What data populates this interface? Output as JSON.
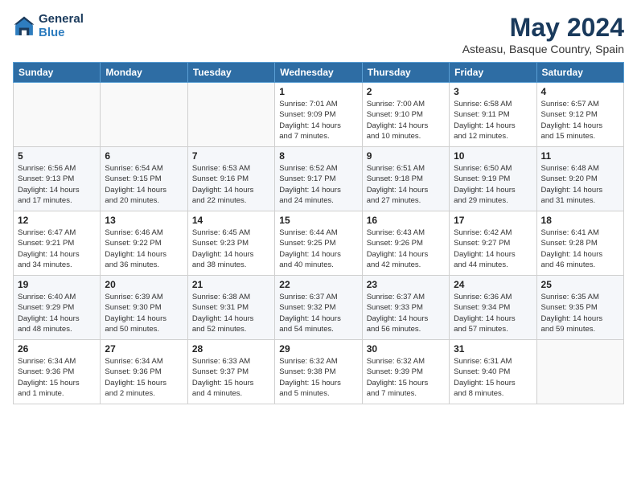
{
  "header": {
    "logo_line1": "General",
    "logo_line2": "Blue",
    "month_year": "May 2024",
    "location": "Asteasu, Basque Country, Spain"
  },
  "weekdays": [
    "Sunday",
    "Monday",
    "Tuesday",
    "Wednesday",
    "Thursday",
    "Friday",
    "Saturday"
  ],
  "weeks": [
    [
      {
        "day": "",
        "info": ""
      },
      {
        "day": "",
        "info": ""
      },
      {
        "day": "",
        "info": ""
      },
      {
        "day": "1",
        "info": "Sunrise: 7:01 AM\nSunset: 9:09 PM\nDaylight: 14 hours\nand 7 minutes."
      },
      {
        "day": "2",
        "info": "Sunrise: 7:00 AM\nSunset: 9:10 PM\nDaylight: 14 hours\nand 10 minutes."
      },
      {
        "day": "3",
        "info": "Sunrise: 6:58 AM\nSunset: 9:11 PM\nDaylight: 14 hours\nand 12 minutes."
      },
      {
        "day": "4",
        "info": "Sunrise: 6:57 AM\nSunset: 9:12 PM\nDaylight: 14 hours\nand 15 minutes."
      }
    ],
    [
      {
        "day": "5",
        "info": "Sunrise: 6:56 AM\nSunset: 9:13 PM\nDaylight: 14 hours\nand 17 minutes."
      },
      {
        "day": "6",
        "info": "Sunrise: 6:54 AM\nSunset: 9:15 PM\nDaylight: 14 hours\nand 20 minutes."
      },
      {
        "day": "7",
        "info": "Sunrise: 6:53 AM\nSunset: 9:16 PM\nDaylight: 14 hours\nand 22 minutes."
      },
      {
        "day": "8",
        "info": "Sunrise: 6:52 AM\nSunset: 9:17 PM\nDaylight: 14 hours\nand 24 minutes."
      },
      {
        "day": "9",
        "info": "Sunrise: 6:51 AM\nSunset: 9:18 PM\nDaylight: 14 hours\nand 27 minutes."
      },
      {
        "day": "10",
        "info": "Sunrise: 6:50 AM\nSunset: 9:19 PM\nDaylight: 14 hours\nand 29 minutes."
      },
      {
        "day": "11",
        "info": "Sunrise: 6:48 AM\nSunset: 9:20 PM\nDaylight: 14 hours\nand 31 minutes."
      }
    ],
    [
      {
        "day": "12",
        "info": "Sunrise: 6:47 AM\nSunset: 9:21 PM\nDaylight: 14 hours\nand 34 minutes."
      },
      {
        "day": "13",
        "info": "Sunrise: 6:46 AM\nSunset: 9:22 PM\nDaylight: 14 hours\nand 36 minutes."
      },
      {
        "day": "14",
        "info": "Sunrise: 6:45 AM\nSunset: 9:23 PM\nDaylight: 14 hours\nand 38 minutes."
      },
      {
        "day": "15",
        "info": "Sunrise: 6:44 AM\nSunset: 9:25 PM\nDaylight: 14 hours\nand 40 minutes."
      },
      {
        "day": "16",
        "info": "Sunrise: 6:43 AM\nSunset: 9:26 PM\nDaylight: 14 hours\nand 42 minutes."
      },
      {
        "day": "17",
        "info": "Sunrise: 6:42 AM\nSunset: 9:27 PM\nDaylight: 14 hours\nand 44 minutes."
      },
      {
        "day": "18",
        "info": "Sunrise: 6:41 AM\nSunset: 9:28 PM\nDaylight: 14 hours\nand 46 minutes."
      }
    ],
    [
      {
        "day": "19",
        "info": "Sunrise: 6:40 AM\nSunset: 9:29 PM\nDaylight: 14 hours\nand 48 minutes."
      },
      {
        "day": "20",
        "info": "Sunrise: 6:39 AM\nSunset: 9:30 PM\nDaylight: 14 hours\nand 50 minutes."
      },
      {
        "day": "21",
        "info": "Sunrise: 6:38 AM\nSunset: 9:31 PM\nDaylight: 14 hours\nand 52 minutes."
      },
      {
        "day": "22",
        "info": "Sunrise: 6:37 AM\nSunset: 9:32 PM\nDaylight: 14 hours\nand 54 minutes."
      },
      {
        "day": "23",
        "info": "Sunrise: 6:37 AM\nSunset: 9:33 PM\nDaylight: 14 hours\nand 56 minutes."
      },
      {
        "day": "24",
        "info": "Sunrise: 6:36 AM\nSunset: 9:34 PM\nDaylight: 14 hours\nand 57 minutes."
      },
      {
        "day": "25",
        "info": "Sunrise: 6:35 AM\nSunset: 9:35 PM\nDaylight: 14 hours\nand 59 minutes."
      }
    ],
    [
      {
        "day": "26",
        "info": "Sunrise: 6:34 AM\nSunset: 9:36 PM\nDaylight: 15 hours\nand 1 minute."
      },
      {
        "day": "27",
        "info": "Sunrise: 6:34 AM\nSunset: 9:36 PM\nDaylight: 15 hours\nand 2 minutes."
      },
      {
        "day": "28",
        "info": "Sunrise: 6:33 AM\nSunset: 9:37 PM\nDaylight: 15 hours\nand 4 minutes."
      },
      {
        "day": "29",
        "info": "Sunrise: 6:32 AM\nSunset: 9:38 PM\nDaylight: 15 hours\nand 5 minutes."
      },
      {
        "day": "30",
        "info": "Sunrise: 6:32 AM\nSunset: 9:39 PM\nDaylight: 15 hours\nand 7 minutes."
      },
      {
        "day": "31",
        "info": "Sunrise: 6:31 AM\nSunset: 9:40 PM\nDaylight: 15 hours\nand 8 minutes."
      },
      {
        "day": "",
        "info": ""
      }
    ]
  ]
}
